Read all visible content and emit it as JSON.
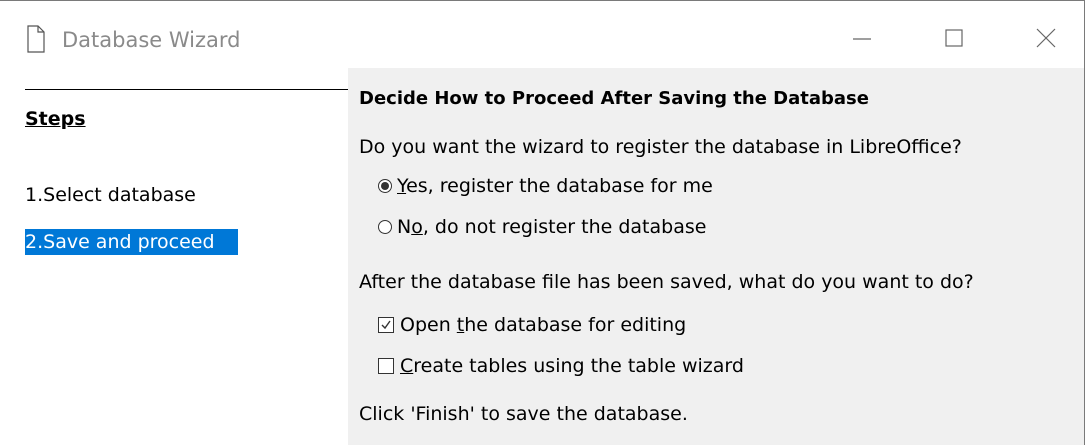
{
  "window": {
    "title": "Database Wizard"
  },
  "titlebar": {
    "app_icon": "document-icon",
    "minimize_icon": "minimize-icon",
    "maximize_icon": "maximize-icon",
    "close_icon": "close-icon"
  },
  "sidebar": {
    "heading": "Steps",
    "steps": [
      {
        "label": "1.Select database",
        "selected": false
      },
      {
        "label": "2.Save and proceed",
        "selected": true
      }
    ],
    "selection_color": "#0078d7"
  },
  "main": {
    "heading": "Decide How to Proceed After Saving the Database",
    "register_question": "Do you want the wizard to register the database in LibreOffice?",
    "register_options": [
      {
        "mnemonic": "Y",
        "rest": "es, register the database for me",
        "checked": true
      },
      {
        "prefix": "N",
        "mnemonic": "o",
        "rest": ", do not register the database",
        "checked": false
      }
    ],
    "after_save_question": "After the database file has been saved, what do you want to do?",
    "after_save_options": [
      {
        "prefix": "Open ",
        "mnemonic": "t",
        "rest": "he database for editing",
        "checked": true
      },
      {
        "mnemonic": "C",
        "rest": "reate tables using the table wizard",
        "checked": false
      }
    ],
    "finish_note": "Click 'Finish' to save the database."
  }
}
